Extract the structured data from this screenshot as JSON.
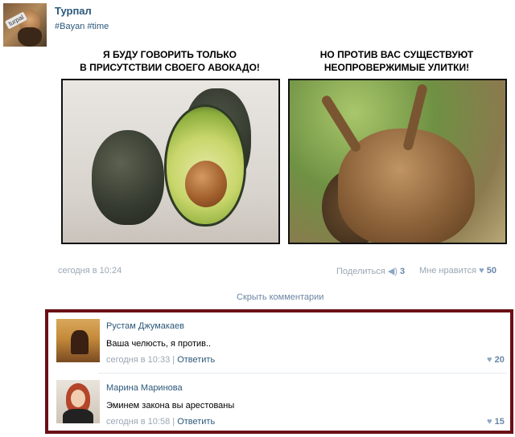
{
  "post": {
    "author": "Турпал",
    "avatar_badge": "turpal",
    "tags": "#Bayan #time",
    "meme": {
      "left_caption": "Я БУДУ ГОВОРИТЬ ТОЛЬКО\nВ ПРИСУТСТВИИ СВОЕГО АВОКАДО!",
      "right_caption": "НО ПРОТИВ ВАС СУЩЕСТВУЮТ\nНЕОПРОВЕРЖИМЫЕ УЛИТКИ!"
    },
    "time": "сегодня в 10:24",
    "platform_icon": "apple-icon",
    "share_label": "Поделиться",
    "share_count": "3",
    "like_label": "Мне нравится",
    "like_count": "50"
  },
  "comments_toggle": "Скрыть комментарии",
  "comments": [
    {
      "name": "Рустам Джумакаев",
      "text": "Ваша челюсть, я против..",
      "time": "сегодня в 10:33",
      "reply": "Ответить",
      "likes": "20"
    },
    {
      "name": "Марина Маринова",
      "text": "Эминем закона вы арестованы",
      "time": "сегодня в 10:58",
      "reply": "Ответить",
      "likes": "15"
    }
  ],
  "colors": {
    "link": "#2b587a",
    "meta": "#9aa7b4",
    "highlight_border": "#6b0f16"
  }
}
